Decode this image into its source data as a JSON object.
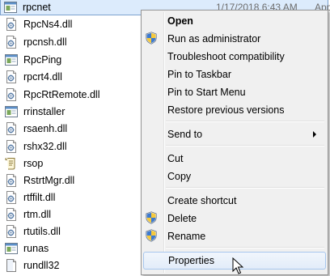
{
  "files": [
    {
      "name": "rpcnet",
      "icon": "program-icon",
      "date": "1/17/2018 6:43 AM",
      "type": "App",
      "selected": true
    },
    {
      "name": "RpcNs4.dll",
      "icon": "dll-icon"
    },
    {
      "name": "rpcnsh.dll",
      "icon": "dll-icon"
    },
    {
      "name": "RpcPing",
      "icon": "program-icon"
    },
    {
      "name": "rpcrt4.dll",
      "icon": "dll-icon"
    },
    {
      "name": "RpcRtRemote.dll",
      "icon": "dll-icon"
    },
    {
      "name": "rrinstaller",
      "icon": "program-icon"
    },
    {
      "name": "rsaenh.dll",
      "icon": "dll-icon"
    },
    {
      "name": "rshx32.dll",
      "icon": "dll-icon"
    },
    {
      "name": "rsop",
      "icon": "console-snapin-icon"
    },
    {
      "name": "RstrtMgr.dll",
      "icon": "dll-icon"
    },
    {
      "name": "rtffilt.dll",
      "icon": "dll-icon"
    },
    {
      "name": "rtm.dll",
      "icon": "dll-icon"
    },
    {
      "name": "rtutils.dll",
      "icon": "dll-icon"
    },
    {
      "name": "runas",
      "icon": "program-icon"
    },
    {
      "name": "rundll32",
      "icon": "blank-file-icon"
    }
  ],
  "context_menu": {
    "items": [
      {
        "label": "Open",
        "bold": true
      },
      {
        "label": "Run as administrator",
        "icon": "uac-shield-icon"
      },
      {
        "label": "Troubleshoot compatibility"
      },
      {
        "label": "Pin to Taskbar"
      },
      {
        "label": "Pin to Start Menu"
      },
      {
        "label": "Restore previous versions"
      },
      {
        "separator": true
      },
      {
        "label": "Send to",
        "submenu": true
      },
      {
        "separator": true
      },
      {
        "label": "Cut"
      },
      {
        "label": "Copy"
      },
      {
        "separator": true
      },
      {
        "label": "Create shortcut"
      },
      {
        "label": "Delete",
        "icon": "uac-shield-icon"
      },
      {
        "label": "Rename",
        "icon": "uac-shield-icon"
      },
      {
        "separator": true
      },
      {
        "label": "Properties",
        "hover": true
      }
    ]
  },
  "colors": {
    "selection_bg": "#dcebfc",
    "selection_border": "#7da2ce",
    "menu_bg": "#f0f0f0",
    "hover_border": "#a8c7ee"
  }
}
